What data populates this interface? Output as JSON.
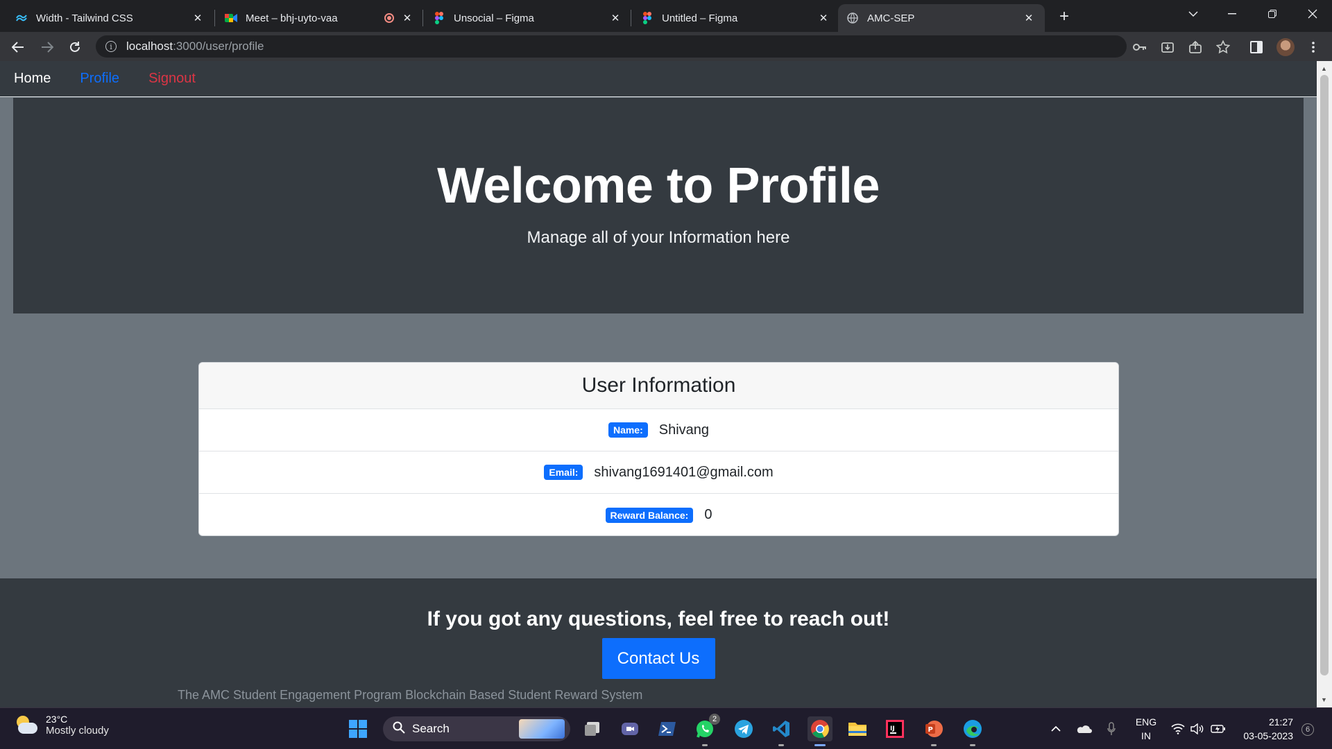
{
  "browser": {
    "tabs": [
      {
        "title": "Width - Tailwind CSS",
        "icon": "tailwind-icon"
      },
      {
        "title": "Meet – bhj-uyto-vaa",
        "icon": "google-meet-icon"
      },
      {
        "title": "Unsocial – Figma",
        "icon": "figma-icon"
      },
      {
        "title": "Untitled – Figma",
        "icon": "figma-icon"
      },
      {
        "title": "AMC-SEP",
        "icon": "globe-icon",
        "active": true
      }
    ],
    "url_host": "localhost",
    "url_path": ":3000/user/profile"
  },
  "site": {
    "nav": {
      "home": "Home",
      "profile": "Profile",
      "signout": "Signout"
    },
    "hero": {
      "title": "Welcome to Profile",
      "subtitle": "Manage all of your Information here"
    },
    "card": {
      "header": "User Information",
      "rows": [
        {
          "label": "Name:",
          "value": "Shivang"
        },
        {
          "label": "Email:",
          "value": "shivang1691401@gmail.com"
        },
        {
          "label": "Reward Balance:",
          "value": "0"
        }
      ]
    },
    "footer": {
      "heading": "If you got any questions, feel free to reach out!",
      "button": "Contact Us",
      "note": "The AMC Student Engagement Program Blockchain Based Student Reward System"
    }
  },
  "taskbar": {
    "weather_temp": "23°C",
    "weather_condition": "Mostly cloudy",
    "search_label": "Search",
    "whatsapp_badge": "2",
    "language_line1": "ENG",
    "language_line2": "IN",
    "time": "21:27",
    "date": "03-05-2023",
    "notification_count": "6"
  },
  "colors": {
    "nav_bg": "#343a40",
    "page_bg": "#6c757d",
    "primary": "#0d6efd",
    "danger": "#dc3545"
  }
}
